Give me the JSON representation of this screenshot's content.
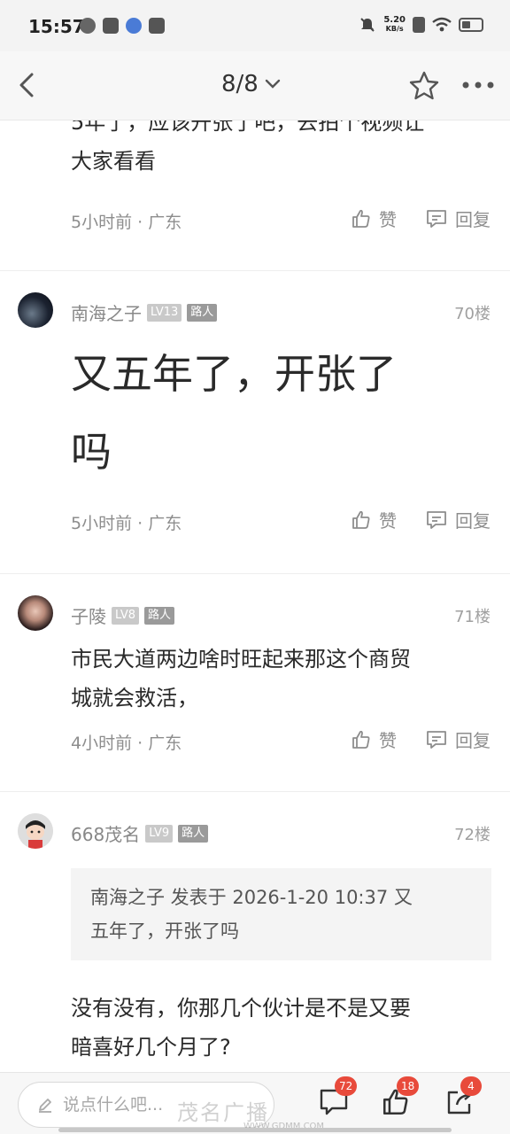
{
  "status": {
    "time": "15:57",
    "net_speed_value": "5.20",
    "net_speed_unit": "KB/s"
  },
  "nav": {
    "page_indicator": "8/8"
  },
  "posts": [
    {
      "partial_text_top": "5年了，应该开张了吧，去拍个视频让",
      "text": "大家看看",
      "time": "5小时前",
      "location": "广东",
      "like_label": "赞",
      "reply_label": "回复"
    },
    {
      "username": "南海之子",
      "level": "LV13",
      "role": "路人",
      "floor": "70楼",
      "text_line1": "又五年了，开张了",
      "text_line2": "吗",
      "time": "5小时前",
      "location": "广东",
      "like_label": "赞",
      "reply_label": "回复"
    },
    {
      "username": "子陵",
      "level": "LV8",
      "role": "路人",
      "floor": "71楼",
      "text_line1": "市民大道两边啥时旺起来那这个商贸",
      "text_line2": "城就会救活，",
      "time": "4小时前",
      "location": "广东",
      "like_label": "赞",
      "reply_label": "回复"
    },
    {
      "username": "668茂名",
      "level": "LV9",
      "role": "路人",
      "floor": "72楼",
      "quote_line1": "南海之子 发表于 2026-1-20 10:37 又",
      "quote_line2": "五年了，开张了吗",
      "text_line1": "没有没有，你那几个伙计是不是又要",
      "text_line2": "暗喜好几个月了?"
    }
  ],
  "bottom": {
    "input_placeholder": "说点什么吧...",
    "comment_count": "72",
    "like_count": "18",
    "share_count": "4"
  },
  "watermark": {
    "text": "茂名广播",
    "sub": "WWW.GDMM.COM"
  },
  "icons": {
    "back": "chevron-left-icon",
    "star": "star-icon",
    "more": "more-dots-icon",
    "like": "thumb-up-icon",
    "reply": "comment-icon",
    "edit": "pencil-icon",
    "share": "share-icon"
  },
  "colors": {
    "badge_count": "#e84a3b",
    "text_primary": "#2a2a2a",
    "text_meta": "#8d8d8d"
  }
}
